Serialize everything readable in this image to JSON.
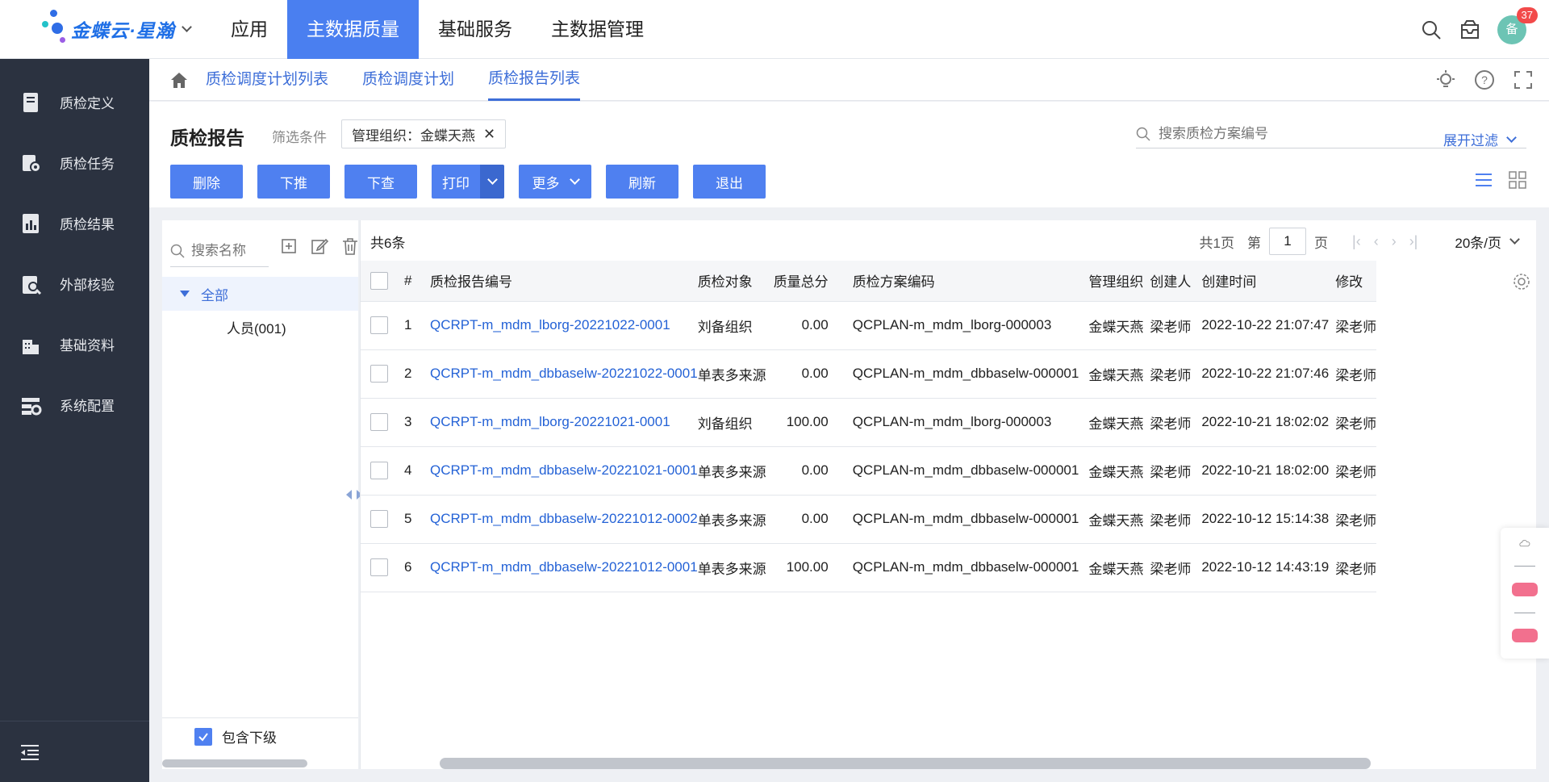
{
  "brand": {
    "name": "金蝶云·星瀚"
  },
  "topnav": {
    "items": [
      "应用",
      "主数据质量",
      "基础服务",
      "主数据管理"
    ],
    "active": "主数据质量"
  },
  "header_right": {
    "badge": "37",
    "avatar_text": "备"
  },
  "sidebar": {
    "items": [
      "质检定义",
      "质检任务",
      "质检结果",
      "外部核验",
      "基础资料",
      "系统配置"
    ]
  },
  "breadcrumb": {
    "tabs": [
      "质检调度计划列表",
      "质检调度计划",
      "质检报告列表"
    ],
    "active": "质检报告列表"
  },
  "page": {
    "title": "质检报告",
    "filter_label": "筛选条件",
    "filter_tag": "管理组织：金蝶天燕",
    "search_placeholder": "搜索质检方案编号",
    "expand_label": "展开过滤"
  },
  "toolbar": {
    "delete": "删除",
    "push_down": "下推",
    "query_down": "下查",
    "print": "打印",
    "more": "更多",
    "refresh": "刷新",
    "exit": "退出"
  },
  "tree": {
    "search_placeholder": "搜索名称",
    "root": "全部",
    "children": [
      "人员(001)"
    ],
    "include_sub": "包含下级"
  },
  "table": {
    "total": "共6条",
    "pager": {
      "pages": "共1页",
      "page_prefix": "第",
      "page_value": "1",
      "page_suffix": "页",
      "page_size": "20条/页"
    },
    "headers": [
      "#",
      "质检报告编号",
      "质检对象",
      "质量总分",
      "质检方案编码",
      "管理组织",
      "创建人",
      "创建时间",
      "修改"
    ],
    "rows": [
      {
        "idx": "1",
        "code": "QCRPT-m_mdm_lborg-20221022-0001",
        "object": "刘备组织",
        "score": "0.00",
        "plan": "QCPLAN-m_mdm_lborg-000003",
        "org": "金蝶天燕",
        "creator": "梁老师",
        "created": "2022-10-22 21:07:47",
        "modifier": "梁老师"
      },
      {
        "idx": "2",
        "code": "QCRPT-m_mdm_dbbaselw-20221022-0001",
        "object": "单表多来源",
        "score": "0.00",
        "plan": "QCPLAN-m_mdm_dbbaselw-000001",
        "org": "金蝶天燕",
        "creator": "梁老师",
        "created": "2022-10-22 21:07:46",
        "modifier": "梁老师"
      },
      {
        "idx": "3",
        "code": "QCRPT-m_mdm_lborg-20221021-0001",
        "object": "刘备组织",
        "score": "100.00",
        "plan": "QCPLAN-m_mdm_lborg-000003",
        "org": "金蝶天燕",
        "creator": "梁老师",
        "created": "2022-10-21 18:02:02",
        "modifier": "梁老师"
      },
      {
        "idx": "4",
        "code": "QCRPT-m_mdm_dbbaselw-20221021-0001",
        "object": "单表多来源",
        "score": "0.00",
        "plan": "QCPLAN-m_mdm_dbbaselw-000001",
        "org": "金蝶天燕",
        "creator": "梁老师",
        "created": "2022-10-21 18:02:00",
        "modifier": "梁老师"
      },
      {
        "idx": "5",
        "code": "QCRPT-m_mdm_dbbaselw-20221012-0002",
        "object": "单表多来源",
        "score": "0.00",
        "plan": "QCPLAN-m_mdm_dbbaselw-000001",
        "org": "金蝶天燕",
        "creator": "梁老师",
        "created": "2022-10-12 15:14:38",
        "modifier": "梁老师"
      },
      {
        "idx": "6",
        "code": "QCRPT-m_mdm_dbbaselw-20221012-0001",
        "object": "单表多来源",
        "score": "100.00",
        "plan": "QCPLAN-m_mdm_dbbaselw-000001",
        "org": "金蝶天燕",
        "creator": "梁老师",
        "created": "2022-10-12 14:43:19",
        "modifier": "梁老师"
      }
    ]
  },
  "colors": {
    "accent": "#4f80f0",
    "link": "#2462d6",
    "sidebar_bg": "#2b3240"
  }
}
